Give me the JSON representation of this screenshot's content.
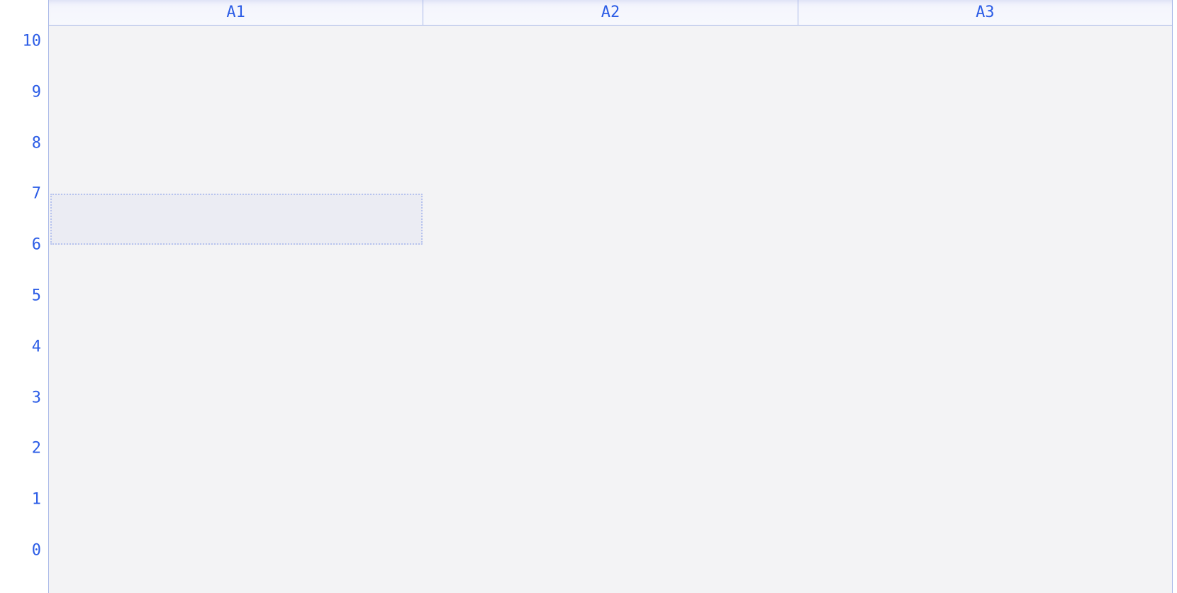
{
  "chart_data": {
    "type": "bar",
    "categories": [
      "A1",
      "A2",
      "A3"
    ],
    "series": [
      {
        "name": "A1",
        "y_range_highlight": [
          6,
          7
        ]
      }
    ],
    "values": [
      null,
      null,
      null
    ],
    "title": "",
    "xlabel": "",
    "ylabel": "",
    "ylim": [
      0,
      10
    ],
    "yticks": [
      10,
      9,
      8,
      7,
      6,
      5,
      4,
      3,
      2,
      1,
      0
    ],
    "highlighted_region": {
      "column": "A1",
      "y_from": 6,
      "y_to": 7
    }
  },
  "columns": {
    "items": [
      {
        "label": "A1"
      },
      {
        "label": "A2"
      },
      {
        "label": "A3"
      }
    ]
  },
  "yaxis": {
    "ticks": [
      "10",
      "9",
      "8",
      "7",
      "6",
      "5",
      "4",
      "3",
      "2",
      "1",
      "0"
    ]
  }
}
